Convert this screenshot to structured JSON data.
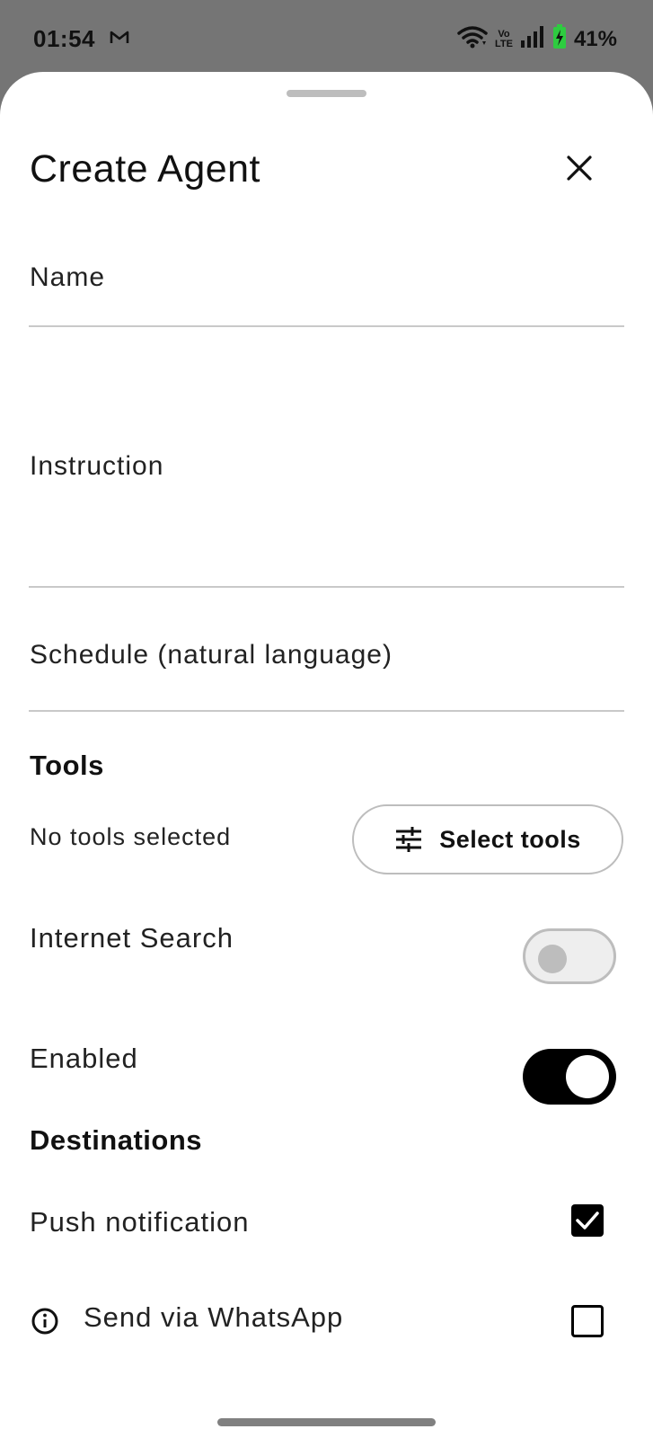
{
  "status_bar": {
    "time": "01:54",
    "battery": "41%",
    "network_label_top": "Vo",
    "network_label_bottom": "LTE",
    "notification_icon": "gmail-icon"
  },
  "sheet": {
    "title": "Create Agent",
    "close_icon": "close-icon"
  },
  "form": {
    "name_label": "Name",
    "instruction_label": "Instruction",
    "schedule_label": "Schedule (natural language)"
  },
  "tools": {
    "section_title": "Tools",
    "status_text": "No tools selected",
    "select_button_label": "Select tools",
    "select_button_icon": "sliders-icon"
  },
  "settings": {
    "internet_search_label": "Internet Search",
    "internet_search_on": false,
    "enabled_label": "Enabled",
    "enabled_on": true
  },
  "destinations": {
    "section_title": "Destinations",
    "push_label": "Push notification",
    "push_checked": true,
    "whatsapp_label": "Send via WhatsApp",
    "whatsapp_checked": false,
    "whatsapp_icon": "info-icon"
  },
  "colors": {
    "status_bar_bg": "#757575",
    "sheet_bg": "#ffffff",
    "toggle_on": "#000000",
    "toggle_off": "#eeeeee",
    "divider": "#c9c9c9",
    "battery_charging": "#2ecc40"
  }
}
